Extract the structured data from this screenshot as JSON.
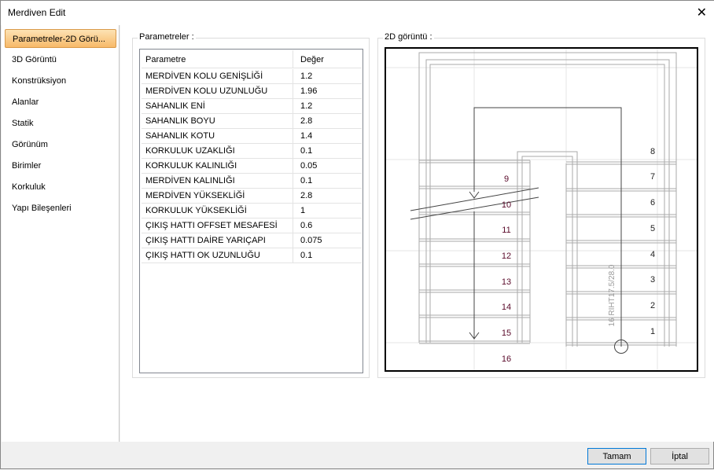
{
  "window": {
    "title": "Merdiven Edit"
  },
  "sidebar": {
    "items": [
      {
        "label": "Parametreler-2D Görü..."
      },
      {
        "label": "3D Görüntü"
      },
      {
        "label": "Konstrüksiyon"
      },
      {
        "label": "Alanlar"
      },
      {
        "label": "Statik"
      },
      {
        "label": "Görünüm"
      },
      {
        "label": "Birimler"
      },
      {
        "label": "Korkuluk"
      },
      {
        "label": "Yapı Bileşenleri"
      }
    ]
  },
  "params": {
    "group_label": "Parametreler :",
    "col_param": "Parametre",
    "col_value": "Değer",
    "rows": [
      {
        "name": "MERDİVEN KOLU GENİŞLİĞİ",
        "value": "1.2"
      },
      {
        "name": "MERDİVEN KOLU UZUNLUĞU",
        "value": "1.96"
      },
      {
        "name": "SAHANLIK ENİ",
        "value": "1.2"
      },
      {
        "name": "SAHANLIK BOYU",
        "value": "2.8"
      },
      {
        "name": "SAHANLIK KOTU",
        "value": "1.4"
      },
      {
        "name": "KORKULUK UZAKLIĞI",
        "value": "0.1"
      },
      {
        "name": "KORKULUK KALINLIĞI",
        "value": "0.05"
      },
      {
        "name": "MERDİVEN KALINLIĞI",
        "value": "0.1"
      },
      {
        "name": "MERDİVEN YÜKSEKLİĞİ",
        "value": "2.8"
      },
      {
        "name": "KORKULUK YÜKSEKLİĞİ",
        "value": "1"
      },
      {
        "name": "ÇIKIŞ HATTI OFFSET MESAFESİ",
        "value": "0.6"
      },
      {
        "name": "ÇIKIŞ HATTI DAİRE YARIÇAPI",
        "value": "0.075"
      },
      {
        "name": "ÇIKIŞ HATTI OK UZUNLUĞU",
        "value": "0.1"
      }
    ]
  },
  "preview": {
    "group_label": "2D görüntü :",
    "riser_label": "16 RIHT17.5/28.0",
    "left_steps": [
      "9",
      "10",
      "11",
      "12",
      "13",
      "14",
      "15",
      "16"
    ],
    "right_steps": [
      "8",
      "7",
      "6",
      "5",
      "4",
      "3",
      "2",
      "1"
    ]
  },
  "buttons": {
    "ok": "Tamam",
    "cancel": "İptal"
  }
}
